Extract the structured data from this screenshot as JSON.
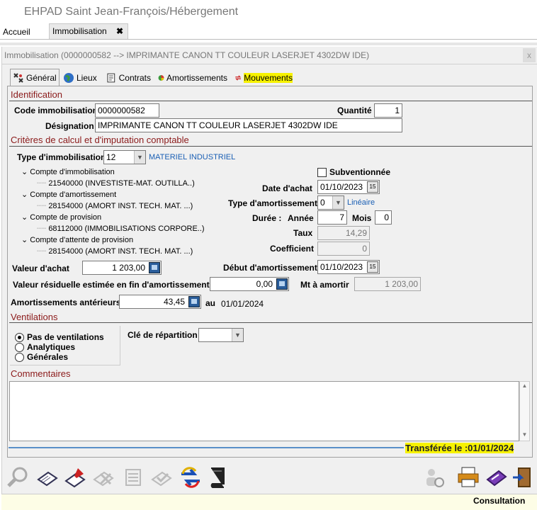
{
  "app": {
    "title": "EHPAD Saint Jean-François/Hébergement"
  },
  "nav": {
    "home": "Accueil",
    "doc_tab": "Immobilisation",
    "doc_tab_close": "✖"
  },
  "window": {
    "title": "Immobilisation (0000000582 --> IMPRIMANTE CANON TT COULEUR LASERJET 4302DW IDE)",
    "close": "x"
  },
  "tabs": [
    {
      "label": "Général"
    },
    {
      "label": "Lieux"
    },
    {
      "label": "Contrats"
    },
    {
      "label": "Amortissements"
    },
    {
      "label": "Mouvements"
    }
  ],
  "identification": {
    "title": "Identification",
    "code_label": "Code immobilisation",
    "code_value": "0000000582",
    "quantite_label": "Quantité",
    "quantite_value": "1",
    "designation_label": "Désignation",
    "designation_value": "IMPRIMANTE CANON TT COULEUR LASERJET 4302DW IDE"
  },
  "criteres": {
    "title": "Critères de calcul et d'imputation comptable",
    "type_label": "Type d'immobilisation",
    "type_value": "12",
    "type_desc": "MATERIEL INDUSTRIEL",
    "tree": [
      {
        "label": "Compte d'immobilisation",
        "child": "21540000 (INVESTISTE-MAT. OUTILLA..)"
      },
      {
        "label": "Compte d'amortissement",
        "child": "28154000 (AMORT INST. TECH. MAT. ...)"
      },
      {
        "label": "Compte de provision",
        "child": "68112000 (IMMOBILISATIONS CORPORE..)"
      },
      {
        "label": "Compte d'attente de provision",
        "child": "28154000 (AMORT INST. TECH. MAT. ...)"
      }
    ],
    "subventionnee_label": "Subventionnée",
    "date_achat_label": "Date d'achat",
    "date_achat_value": "01/10/2023",
    "type_amort_label": "Type d'amortissement",
    "type_amort_value": "0",
    "type_amort_desc": "Linéaire",
    "duree_label": "Durée :",
    "annee_label": "Année",
    "annee_value": "7",
    "mois_label": "Mois",
    "mois_value": "0",
    "taux_label": "Taux",
    "taux_value": "14,29",
    "coef_label": "Coefficient",
    "coef_value": "0",
    "valeur_achat_label": "Valeur d'achat",
    "valeur_achat_value": "1 203,00",
    "debut_amort_label": "Début d'amortissement",
    "debut_amort_value": "01/10/2023",
    "valeur_resid_label": "Valeur résiduelle estimée en fin d'amortissement",
    "valeur_resid_value": "0,00",
    "mt_amortir_label": "Mt à amortir",
    "mt_amortir_value": "1 203,00",
    "amort_ant_label": "Amortissements antérieurs",
    "amort_ant_value": "43,45",
    "au_label": "au",
    "au_date": "01/01/2024",
    "cal_glyph": "15"
  },
  "ventilations": {
    "title": "Ventilations",
    "options": [
      "Pas de ventilations",
      "Analytiques",
      "Générales"
    ],
    "cle_label": "Clé de répartition"
  },
  "commentaires": {
    "title": "Commentaires"
  },
  "transfer": {
    "text": "Transférée le :01/01/2024"
  },
  "status": {
    "text": "Consultation"
  },
  "colors": {
    "section": "#8b1a1a",
    "highlight": "#f7f200",
    "link": "#1a5fb4"
  }
}
